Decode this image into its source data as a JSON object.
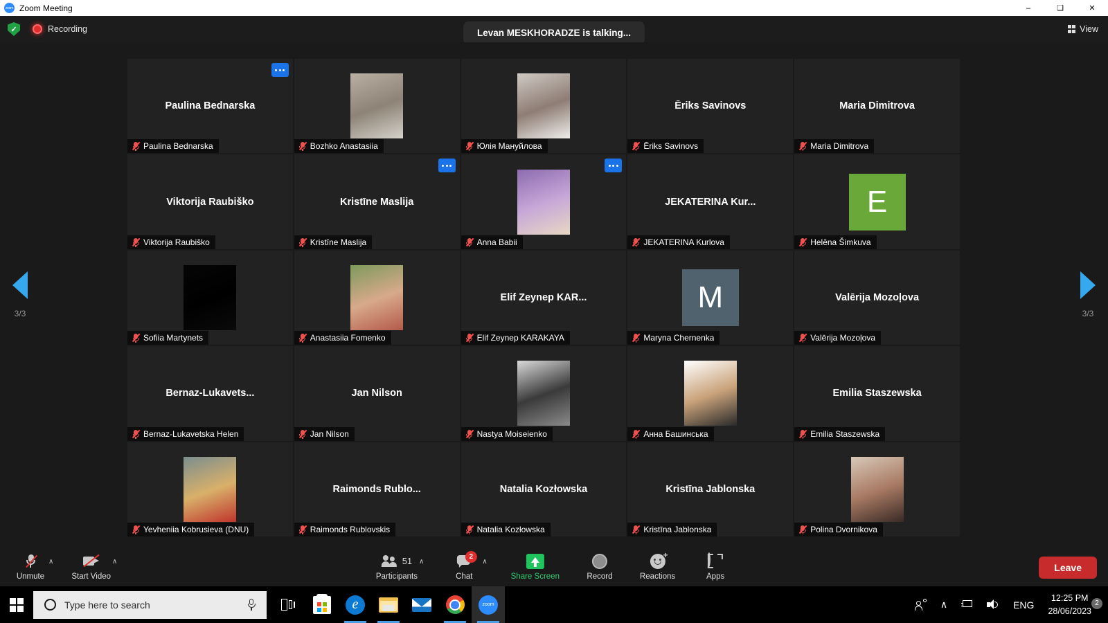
{
  "window": {
    "app_icon": "zoom-logo-icon",
    "title": "Zoom Meeting",
    "minimize": "–",
    "maximize": "❑",
    "close": "✕"
  },
  "topbar": {
    "encryption_icon": "shield-check-icon",
    "recording_icon": "recording-dot-icon",
    "recording_label": "Recording",
    "talking_banner": "Levan MESKHORADZE is talking...",
    "view_icon": "grid-view-icon",
    "view_label": "View"
  },
  "gallery": {
    "prev_icon": "chevron-left-icon",
    "prev_page_indicator": "3/3",
    "next_icon": "chevron-right-icon",
    "next_page_indicator": "3/3",
    "tiles": [
      {
        "display_name": "Paulina Bednarska",
        "name_label": "Paulina Bednarska",
        "avatar": "none",
        "muted": true,
        "more": true
      },
      {
        "display_name": "",
        "name_label": "Bozhko Anastasiia",
        "avatar": "photo",
        "photo_colors": [
          "#b9b0a3",
          "#8d8376",
          "#d5d2cb"
        ],
        "muted": true,
        "more": false
      },
      {
        "display_name": "",
        "name_label": "Юлія Мануйлова",
        "avatar": "photo",
        "photo_colors": [
          "#cfcac4",
          "#8e7d74",
          "#efeeec"
        ],
        "muted": true,
        "more": false
      },
      {
        "display_name": "Ēriks Savinovs",
        "name_label": "Ēriks Savinovs",
        "avatar": "none",
        "muted": true,
        "more": false
      },
      {
        "display_name": "Maria Dimitrova",
        "name_label": "Maria Dimitrova",
        "avatar": "none",
        "muted": true,
        "more": false
      },
      {
        "display_name": "Viktorija Raubiško",
        "name_label": "Viktorija Raubiško",
        "avatar": "none",
        "muted": true,
        "more": false
      },
      {
        "display_name": "Kristīne Maslija",
        "name_label": "Kristīne Maslija",
        "avatar": "none",
        "muted": true,
        "more": true
      },
      {
        "display_name": "",
        "name_label": "Anna Babii",
        "avatar": "photo",
        "photo_colors": [
          "#8d6bb0",
          "#c7a7d8",
          "#e8d8c4"
        ],
        "muted": true,
        "more": true
      },
      {
        "display_name": "JEKATERINA  Kur...",
        "name_label": "JEKATERINA Kurlova",
        "avatar": "none",
        "muted": true,
        "more": false
      },
      {
        "display_name": "",
        "name_label": "Helēna Šimkuva",
        "avatar": "letter",
        "letter": "E",
        "letter_bg": "#6aa83a",
        "muted": true,
        "more": false
      },
      {
        "display_name": "",
        "name_label": "Sofiia Martynets",
        "avatar": "photo",
        "photo_colors": [
          "#050505",
          "#000000",
          "#0a0a0a"
        ],
        "muted": true,
        "more": false
      },
      {
        "display_name": "",
        "name_label": "Anastasiia Fomenko",
        "avatar": "photo",
        "photo_colors": [
          "#7d9a5a",
          "#d8a98c",
          "#b45a4a"
        ],
        "muted": true,
        "more": false
      },
      {
        "display_name": "Elif  Zeynep KAR...",
        "name_label": "Elif Zeynep KARAKAYA",
        "avatar": "none",
        "muted": true,
        "more": false
      },
      {
        "display_name": "",
        "name_label": "Maryna Chernenka",
        "avatar": "letter",
        "letter": "M",
        "letter_bg": "#50626e",
        "muted": true,
        "more": false
      },
      {
        "display_name": "Valērija Mozoļova",
        "name_label": "Valērija Mozoļova",
        "avatar": "none",
        "muted": true,
        "more": false
      },
      {
        "display_name": "Bernaz-Lukavets...",
        "name_label": "Bernaz-Lukavetska Helen",
        "avatar": "none",
        "muted": true,
        "more": false
      },
      {
        "display_name": "Jan Nilson",
        "name_label": "Jan Nilson",
        "avatar": "none",
        "muted": true,
        "more": false
      },
      {
        "display_name": "",
        "name_label": "Nastya Moiseienko",
        "avatar": "photo",
        "photo_colors": [
          "#d9d9d9",
          "#3a3a3a",
          "#8a8a8a"
        ],
        "muted": true,
        "more": false
      },
      {
        "display_name": "",
        "name_label": "Анна Башинська",
        "avatar": "photo",
        "photo_colors": [
          "#ffffff",
          "#c9a27a",
          "#2a2a2a"
        ],
        "muted": true,
        "more": false
      },
      {
        "display_name": "Emilia Staszewska",
        "name_label": "Emilia Staszewska",
        "avatar": "none",
        "muted": true,
        "more": false
      },
      {
        "display_name": "",
        "name_label": "Yevheniia Kobrusieva (DNU)",
        "avatar": "photo",
        "photo_colors": [
          "#7b8e8f",
          "#d9b06a",
          "#c0342c"
        ],
        "muted": true,
        "more": false
      },
      {
        "display_name": "Raimonds  Rublo...",
        "name_label": "Raimonds Rublovskis",
        "avatar": "none",
        "muted": true,
        "more": false
      },
      {
        "display_name": "Natalia Kozłowska",
        "name_label": "Natalia Kozłowska",
        "avatar": "none",
        "muted": true,
        "more": false
      },
      {
        "display_name": "Kristīna Jablonska",
        "name_label": "Kristīna Jablonska",
        "avatar": "none",
        "muted": true,
        "more": false
      },
      {
        "display_name": "",
        "name_label": "Polina Dvornikova",
        "avatar": "photo",
        "photo_colors": [
          "#d8c8b8",
          "#a87a63",
          "#3a2a26"
        ],
        "muted": true,
        "more": false
      }
    ]
  },
  "toolbar": {
    "unmute": {
      "icon": "microphone-muted-icon",
      "label": "Unmute",
      "caret": "∧"
    },
    "start_video": {
      "icon": "camera-off-icon",
      "label": "Start Video",
      "caret": "∧"
    },
    "participants": {
      "icon": "participants-icon",
      "label": "Participants",
      "count": "51",
      "caret": "∧"
    },
    "chat": {
      "icon": "chat-bubble-icon",
      "label": "Chat",
      "badge": "2",
      "caret": "∧"
    },
    "share_screen": {
      "icon": "share-screen-icon",
      "label": "Share Screen"
    },
    "record": {
      "icon": "record-circle-icon",
      "label": "Record"
    },
    "reactions": {
      "icon": "reactions-smiley-icon",
      "label": "Reactions"
    },
    "apps": {
      "icon": "apps-icon",
      "label": "Apps"
    },
    "leave_label": "Leave"
  },
  "taskbar": {
    "start_icon": "windows-start-icon",
    "search_placeholder": "Type here to search",
    "search_value": "",
    "search_mic_icon": "microphone-icon",
    "apps": [
      {
        "icon": "task-view-icon",
        "name": "task-view"
      },
      {
        "icon": "microsoft-store-icon",
        "name": "microsoft-store"
      },
      {
        "icon": "edge-icon",
        "name": "microsoft-edge"
      },
      {
        "icon": "file-explorer-icon",
        "name": "file-explorer"
      },
      {
        "icon": "mail-icon",
        "name": "mail"
      },
      {
        "icon": "chrome-icon",
        "name": "google-chrome"
      },
      {
        "icon": "zoom-icon",
        "name": "zoom"
      }
    ],
    "tray": {
      "people_icon": "people-icon",
      "chevron_icon": "∧",
      "network_icon": "network-monitor-icon",
      "volume_icon": "speaker-icon",
      "language": "ENG",
      "time": "12:25 PM",
      "date": "28/06/2023",
      "notification_icon": "notification-icon",
      "notification_count": "2"
    }
  }
}
